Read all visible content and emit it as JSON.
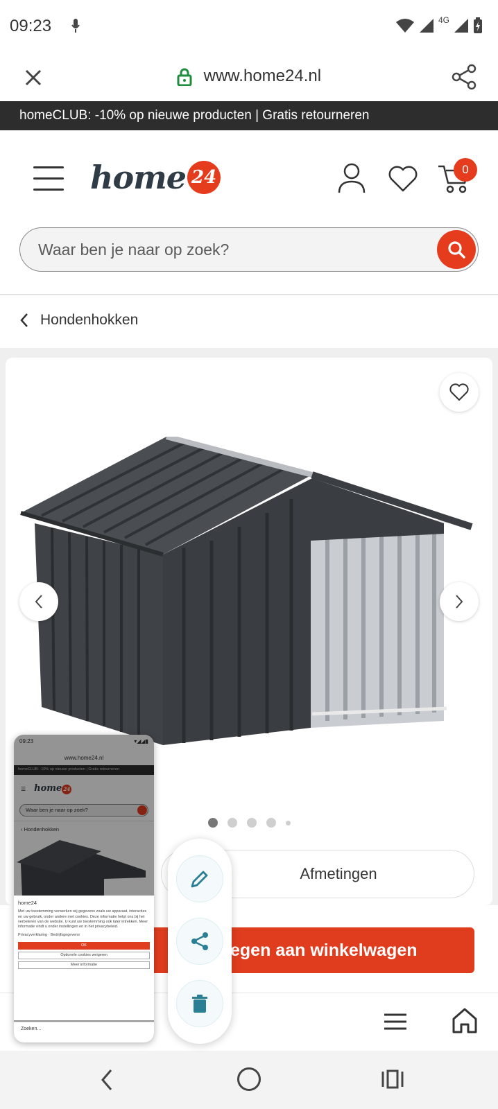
{
  "status_bar": {
    "time": "09:23",
    "network": "4G"
  },
  "browser": {
    "url": "www.home24.nl"
  },
  "promo": {
    "text": "homeCLUB: -10% op nieuwe producten | Gratis retourneren"
  },
  "header": {
    "logo_text": "home",
    "logo_badge": "24",
    "cart_count": "0"
  },
  "search": {
    "placeholder": "Waar ben je naar op zoek?"
  },
  "breadcrumb": {
    "label": "Hondenhokken"
  },
  "gallery": {
    "image_alt": "Dark grey metal dog kennel with open run",
    "slide_count": 5,
    "active_slide": 1
  },
  "actions": {
    "dimensions_label": "Afmetingen",
    "add_to_cart_label": "egen aan winkelwagen"
  },
  "preview": {
    "time": "09:23",
    "url": "www.home24.nl",
    "promo": "homeCLUB: -10% op nieuwe producten | Gratis retourneren",
    "logo_text": "home",
    "logo_badge": "24",
    "search": "Waar ben je naar op zoek?",
    "crumb": "Hondenhokken",
    "cookie_title": "home24",
    "cookie_text": "Met uw toestemming verwerken wij gegevens zoals uw apparaat, interacties en uw gebruik, onder andere met cookies. Deze informatie helpt ons bij het verbeteren van de website. U kunt uw toestemming ook later intrekken. Meer informatie vindt u onder instellingen en in het privacybeleid.",
    "cookie_links": "Privacyverklaring · Bedrijfsgegevens",
    "ok": "OK",
    "optional": "Optionele cookies weigeren",
    "more": "Meer informatie",
    "bottom_search": "Zoeken..."
  },
  "colors": {
    "brand": "#e63c1e",
    "promo_bg": "#2d2d2d",
    "fab_icon": "#2a7f95"
  }
}
